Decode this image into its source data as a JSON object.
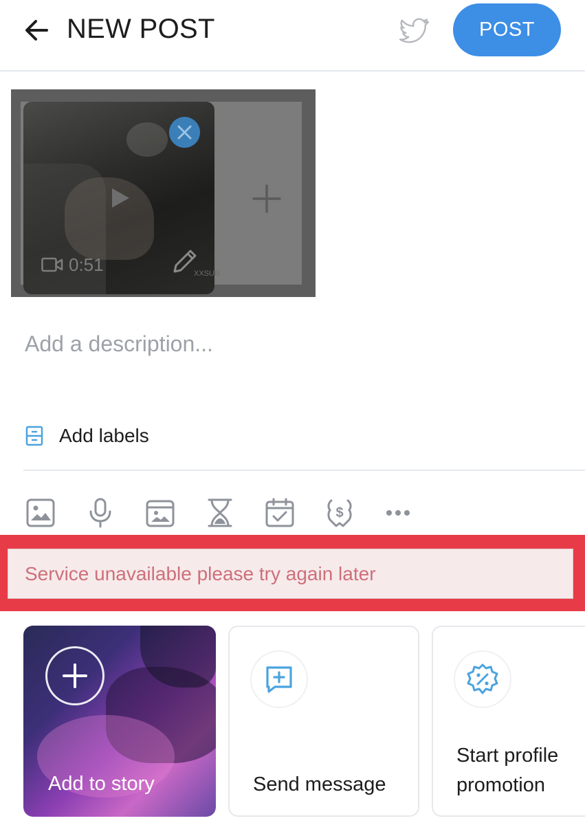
{
  "header": {
    "title": "NEW POST",
    "post_label": "POST"
  },
  "media": {
    "duration": "0:51",
    "watermark": "XXSUB"
  },
  "description": {
    "placeholder": "Add a description..."
  },
  "labels": {
    "label": "Add labels"
  },
  "toolbar": {
    "items": [
      "image-icon",
      "microphone-icon",
      "gallery-vault-icon",
      "hourglass-icon",
      "calendar-check-icon",
      "price-tag-icon",
      "more-icon"
    ]
  },
  "error": {
    "message": "Service unavailable please try again later"
  },
  "cards": {
    "story_label": "Add to story",
    "message_label": "Send message",
    "promo_line1": "Start profile",
    "promo_line2": "promotion"
  },
  "colors": {
    "accent": "#3d8ee5",
    "error_border": "#e73c47",
    "error_text": "#cd7079",
    "icon_gray": "#8e929a",
    "icon_blue": "#4aa3df"
  }
}
